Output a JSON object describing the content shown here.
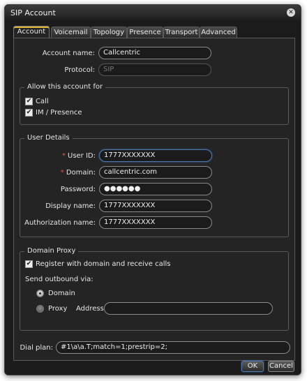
{
  "window": {
    "title": "SIP Account"
  },
  "tabs": [
    "Account",
    "Voicemail",
    "Topology",
    "Presence",
    "Transport",
    "Advanced"
  ],
  "account": {
    "account_name_label": "Account name:",
    "account_name_value": "Callcentric",
    "protocol_label": "Protocol:",
    "protocol_value": "SIP"
  },
  "allow": {
    "title": "Allow this account for",
    "call_label": "Call",
    "im_label": "IM / Presence"
  },
  "user_details": {
    "title": "User Details",
    "required_mark": "*",
    "user_id_label": "User ID:",
    "user_id_value": "1777XXXXXXX",
    "domain_label": "Domain:",
    "domain_value": "callcentric.com",
    "password_label": "Password:",
    "password_value": "●●●●●●",
    "display_name_label": "Display name:",
    "display_name_value": "1777XXXXXXX",
    "auth_name_label": "Authorization name:",
    "auth_name_value": "1777XXXXXXX"
  },
  "domain_proxy": {
    "title": "Domain Proxy",
    "register_label": "Register with domain and receive calls",
    "send_via_label": "Send outbound via:",
    "domain_option": "Domain",
    "proxy_option": "Proxy",
    "address_label": "Address:",
    "address_value": ""
  },
  "dial_plan": {
    "label": "Dial plan:",
    "value": "#1\\a\\a.T;match=1;prestrip=2;"
  },
  "buttons": {
    "ok": "OK",
    "cancel": "Cancel"
  },
  "icons": {
    "close": "close-icon",
    "check": "✔"
  },
  "colors": {
    "accent_tab": "#e3b93a",
    "focus": "#4b78b0",
    "required": "#ff4a3a"
  }
}
